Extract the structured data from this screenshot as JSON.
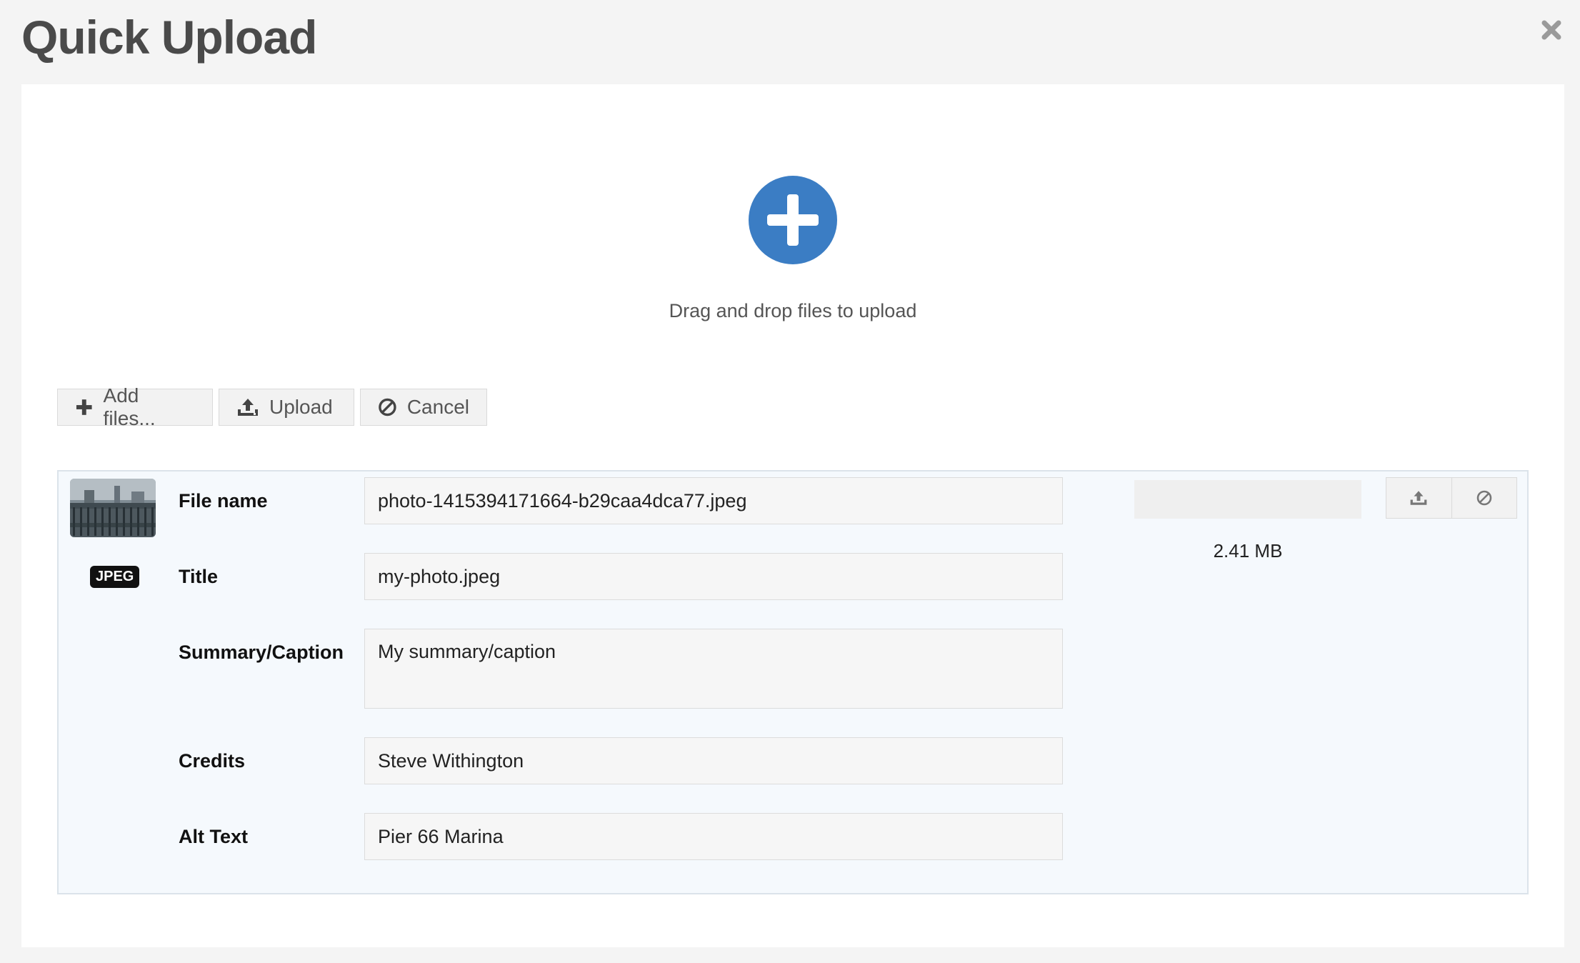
{
  "dialog": {
    "title": "Quick Upload"
  },
  "dropzone": {
    "text": "Drag and drop files to upload"
  },
  "toolbar": {
    "add_files_label": "Add files...",
    "upload_label": "Upload",
    "cancel_label": "Cancel"
  },
  "file": {
    "badge": "JPEG",
    "labels": {
      "file_name": "File name",
      "title": "Title",
      "summary": "Summary/Caption",
      "credits": "Credits",
      "alt_text": "Alt Text"
    },
    "values": {
      "file_name": "photo-1415394171664-b29caa4dca77.jpeg",
      "title": "my-photo.jpeg",
      "summary": "My summary/caption",
      "credits": "Steve Withington",
      "alt_text": "Pier 66 Marina"
    },
    "size": "2.41 MB",
    "progress_percent": 0
  },
  "colors": {
    "accent": "#3b7dc4",
    "row_background": "#f5f9fd"
  },
  "icons": {
    "close": "close-icon",
    "add": "plus-circle-icon",
    "add_files": "plus-icon",
    "upload": "upload-icon",
    "cancel": "ban-icon"
  }
}
